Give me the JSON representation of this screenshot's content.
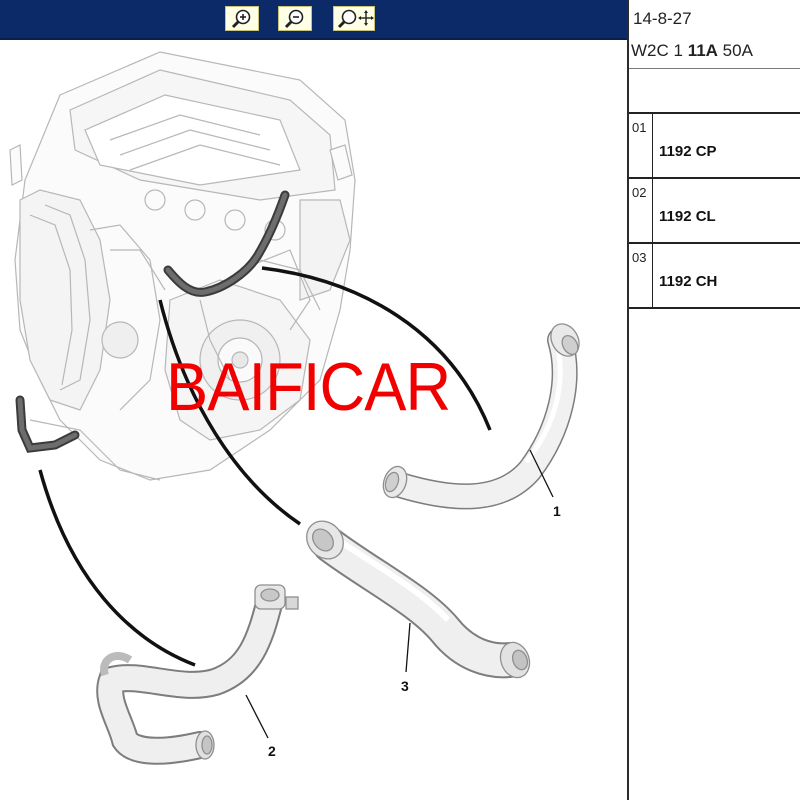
{
  "toolbar": {
    "zoom_in": {
      "icon": "zoom-in-icon"
    },
    "zoom_out": {
      "icon": "zoom-out-icon"
    },
    "zoom_pan": {
      "icon": "zoom-pan-icon"
    }
  },
  "diagram": {
    "callouts": [
      "1",
      "2",
      "3"
    ]
  },
  "watermark": "BAIFICAR",
  "header": {
    "date": "14-8-27",
    "code_parts": [
      "W2C 1 ",
      "11A",
      " 50A"
    ]
  },
  "parts": [
    {
      "index": "01",
      "code": "1192 CP"
    },
    {
      "index": "02",
      "code": "1192 CL"
    },
    {
      "index": "03",
      "code": "1192 CH"
    }
  ],
  "colors": {
    "toolbar_bg": "#0c2a67",
    "watermark": "#f20000"
  }
}
